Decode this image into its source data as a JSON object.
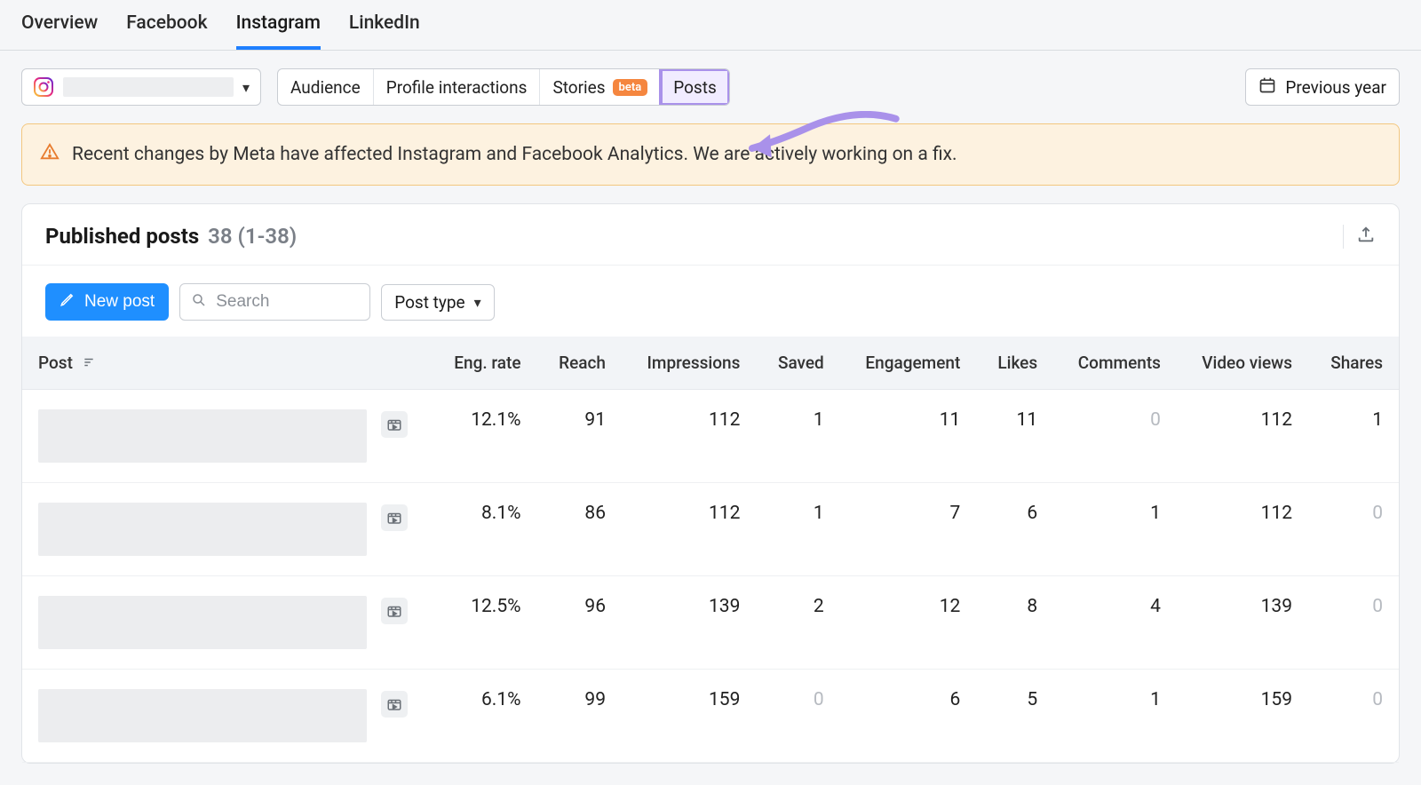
{
  "nav_tabs": {
    "overview": "Overview",
    "facebook": "Facebook",
    "instagram": "Instagram",
    "linkedin": "LinkedIn",
    "active": "instagram"
  },
  "sub_tabs": {
    "audience": "Audience",
    "profile_interactions": "Profile interactions",
    "stories": "Stories",
    "stories_badge": "beta",
    "posts": "Posts"
  },
  "date_filter": {
    "label": "Previous year"
  },
  "alert": {
    "text": "Recent changes by Meta have affected Instagram and Facebook Analytics. We are actively working on a fix."
  },
  "section": {
    "title": "Published posts",
    "count_text": "38 (1-38)"
  },
  "controls": {
    "new_post": "New post",
    "search_placeholder": "Search",
    "post_type_label": "Post type"
  },
  "table": {
    "columns": {
      "post": "Post",
      "eng_rate": "Eng. rate",
      "reach": "Reach",
      "impressions": "Impressions",
      "saved": "Saved",
      "engagement": "Engagement",
      "likes": "Likes",
      "comments": "Comments",
      "video_views": "Video views",
      "shares": "Shares"
    },
    "rows": [
      {
        "eng_rate": "12.1%",
        "reach": "91",
        "impressions": "112",
        "saved": "1",
        "engagement": "11",
        "likes": "11",
        "comments": "0",
        "comments_dim": true,
        "video_views": "112",
        "shares": "1"
      },
      {
        "eng_rate": "8.1%",
        "reach": "86",
        "impressions": "112",
        "saved": "1",
        "engagement": "7",
        "likes": "6",
        "comments": "1",
        "video_views": "112",
        "shares": "0",
        "shares_dim": true
      },
      {
        "eng_rate": "12.5%",
        "reach": "96",
        "impressions": "139",
        "saved": "2",
        "engagement": "12",
        "likes": "8",
        "comments": "4",
        "video_views": "139",
        "shares": "0",
        "shares_dim": true
      },
      {
        "eng_rate": "6.1%",
        "reach": "99",
        "impressions": "159",
        "saved": "0",
        "saved_dim": true,
        "engagement": "6",
        "likes": "5",
        "comments": "1",
        "video_views": "159",
        "shares": "0",
        "shares_dim": true
      }
    ]
  }
}
